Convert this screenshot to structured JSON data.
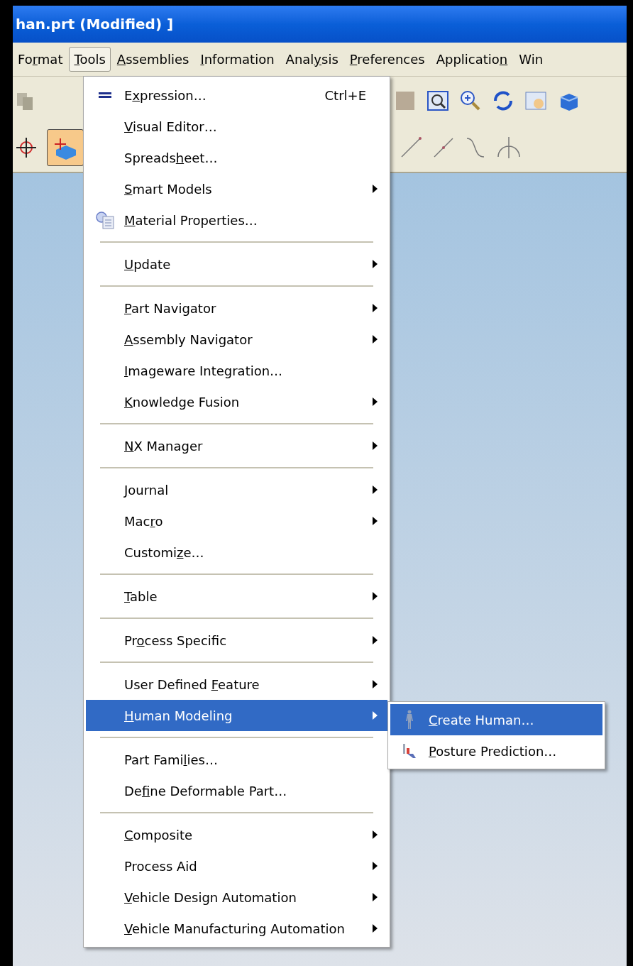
{
  "window": {
    "title": "han.prt (Modified) ]"
  },
  "menubar": [
    {
      "pre": "Fo",
      "key": "r",
      "post": "mat",
      "selected": false
    },
    {
      "key": "T",
      "post": "ools",
      "selected": true
    },
    {
      "key": "A",
      "post": "ssemblies",
      "selected": false
    },
    {
      "key": "I",
      "post": "nformation",
      "selected": false
    },
    {
      "pre": "Anal",
      "key": "y",
      "post": "sis",
      "selected": false
    },
    {
      "key": "P",
      "post": "references",
      "selected": false
    },
    {
      "pre": "Applicatio",
      "key": "n",
      "selected": false
    },
    {
      "pre": "Win",
      "selected": false
    }
  ],
  "tools_menu": [
    {
      "kind": "icon_item",
      "pre": "E",
      "key": "x",
      "post": "pression…",
      "shortcut": "Ctrl+E",
      "submenu": false,
      "selected": false
    },
    {
      "kind": "item",
      "key": "V",
      "post": "isual Editor…",
      "submenu": false,
      "selected": false
    },
    {
      "kind": "item",
      "pre": "Spreads",
      "key": "h",
      "post": "eet…",
      "submenu": false,
      "selected": false
    },
    {
      "kind": "item",
      "key": "S",
      "post": "mart Models",
      "submenu": true,
      "selected": false
    },
    {
      "kind": "icon_item",
      "key": "M",
      "post": "aterial Properties…",
      "submenu": false,
      "selected": false
    },
    {
      "kind": "separator"
    },
    {
      "kind": "item",
      "key": "U",
      "post": "pdate",
      "submenu": true,
      "selected": false
    },
    {
      "kind": "separator"
    },
    {
      "kind": "item",
      "key": "P",
      "post": "art Navigator",
      "submenu": true,
      "selected": false
    },
    {
      "kind": "item",
      "key": "A",
      "post": "ssembly Navigator",
      "submenu": true,
      "selected": false
    },
    {
      "kind": "item",
      "key": "I",
      "post": "mageware Integration…",
      "submenu": false,
      "selected": false
    },
    {
      "kind": "item",
      "key": "K",
      "post": "nowledge Fusion",
      "submenu": true,
      "selected": false
    },
    {
      "kind": "separator"
    },
    {
      "kind": "item",
      "key": "N",
      "post": "X Manager",
      "submenu": true,
      "selected": false
    },
    {
      "kind": "separator"
    },
    {
      "kind": "item",
      "key": "J",
      "post": "ournal",
      "submenu": true,
      "selected": false
    },
    {
      "kind": "item",
      "pre": "Mac",
      "key": "r",
      "post": "o",
      "submenu": true,
      "selected": false
    },
    {
      "kind": "item",
      "pre": "Customi",
      "key": "z",
      "post": "e…",
      "submenu": false,
      "selected": false
    },
    {
      "kind": "separator"
    },
    {
      "kind": "item",
      "key": "T",
      "post": "able",
      "submenu": true,
      "selected": false
    },
    {
      "kind": "separator"
    },
    {
      "kind": "item",
      "pre": "Pr",
      "key": "o",
      "post": "cess Specific",
      "submenu": true,
      "selected": false
    },
    {
      "kind": "separator"
    },
    {
      "kind": "item",
      "pre": "User Defined ",
      "key": "F",
      "post": "eature",
      "submenu": true,
      "selected": false
    },
    {
      "kind": "item",
      "key": "H",
      "post": "uman Modeling",
      "submenu": true,
      "selected": true
    },
    {
      "kind": "separator"
    },
    {
      "kind": "item",
      "pre": "Part Fami",
      "key": "l",
      "post": "ies…",
      "submenu": false,
      "selected": false
    },
    {
      "kind": "item",
      "pre": "De",
      "key": "f",
      "post": "ine Deformable Part…",
      "submenu": false,
      "selected": false
    },
    {
      "kind": "separator"
    },
    {
      "kind": "item",
      "key": "C",
      "post": "omposite",
      "submenu": true,
      "selected": false
    },
    {
      "kind": "item",
      "pre": "Process Aid",
      "submenu": true,
      "selected": false
    },
    {
      "kind": "item",
      "key": "V",
      "post": "ehicle Design Automation",
      "submenu": true,
      "selected": false
    },
    {
      "kind": "item",
      "key": "V",
      "post": "ehicle Manufacturing Automation",
      "submenu": true,
      "selected": false
    }
  ],
  "submenu": [
    {
      "kind": "icon_item",
      "key": "C",
      "post": "reate Human…",
      "selected": true
    },
    {
      "kind": "icon_item",
      "key": "P",
      "post": "osture Prediction…",
      "selected": false
    }
  ]
}
